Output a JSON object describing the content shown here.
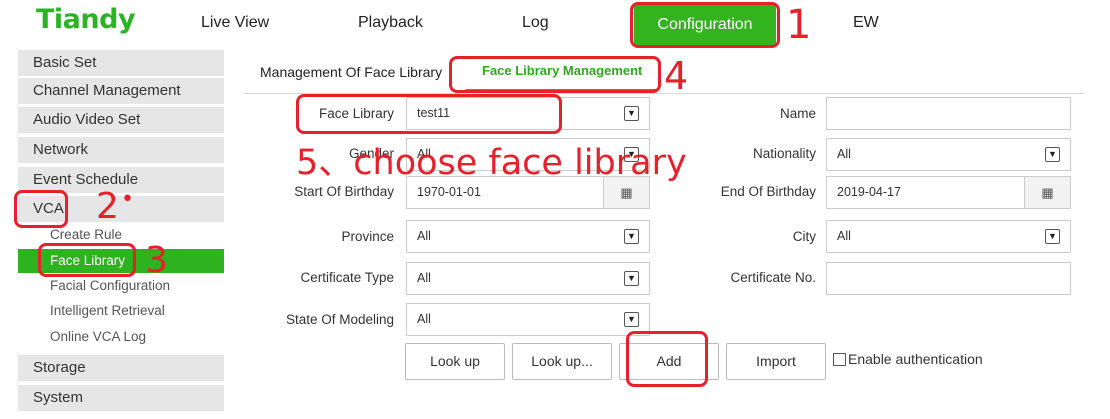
{
  "app": {
    "logo": "Tiandy"
  },
  "nav": {
    "live_view": "Live View",
    "playback": "Playback",
    "log": "Log",
    "configuration": "Configuration",
    "ew": "EW"
  },
  "sidebar": {
    "basic_set": "Basic Set",
    "channel_management": "Channel Management",
    "audio_video_set": "Audio Video Set",
    "network": "Network",
    "event_schedule": "Event Schedule",
    "vca": "VCA",
    "sub": {
      "create_rule": "Create Rule",
      "face_library": "Face Library",
      "facial_configuration": "Facial Configuration",
      "intelligent_retrieval": "Intelligent Retrieval",
      "online_vca_log": "Online VCA Log"
    },
    "storage": "Storage",
    "system": "System"
  },
  "tabs": {
    "management_of_face_library": "Management Of Face Library",
    "face_library_management": "Face Library Management"
  },
  "form": {
    "face_library": {
      "label": "Face Library",
      "value": "test11"
    },
    "gender": {
      "label": "Gender",
      "value": "All"
    },
    "start_birthday": {
      "label": "Start Of Birthday",
      "value": "1970-01-01"
    },
    "province": {
      "label": "Province",
      "value": "All"
    },
    "certificate_type": {
      "label": "Certificate Type",
      "value": "All"
    },
    "state_of_modeling": {
      "label": "State Of Modeling",
      "value": "All"
    },
    "name": {
      "label": "Name",
      "value": ""
    },
    "nationality": {
      "label": "Nationality",
      "value": "All"
    },
    "end_birthday": {
      "label": "End Of Birthday",
      "value": "2019-04-17"
    },
    "city": {
      "label": "City",
      "value": "All"
    },
    "certificate_no": {
      "label": "Certificate No.",
      "value": ""
    }
  },
  "buttons": {
    "look_up": "Look up",
    "look_up_more": "Look up...",
    "add": "Add",
    "import": "Import"
  },
  "enable_authentication": "Enable authentication",
  "annotations": {
    "step1": "1",
    "step2": "2",
    "step2_dot": "•",
    "step3": "3",
    "step4": "4",
    "step5": "5、choose face library"
  },
  "icons": {
    "select": "chevron-down-icon",
    "calendar": "calendar-icon"
  },
  "colors": {
    "brand_green": "#2cb324",
    "active_green": "#2fb21f",
    "annotation_red": "#e8202a",
    "sidebar_gray": "#e6e6e6"
  }
}
